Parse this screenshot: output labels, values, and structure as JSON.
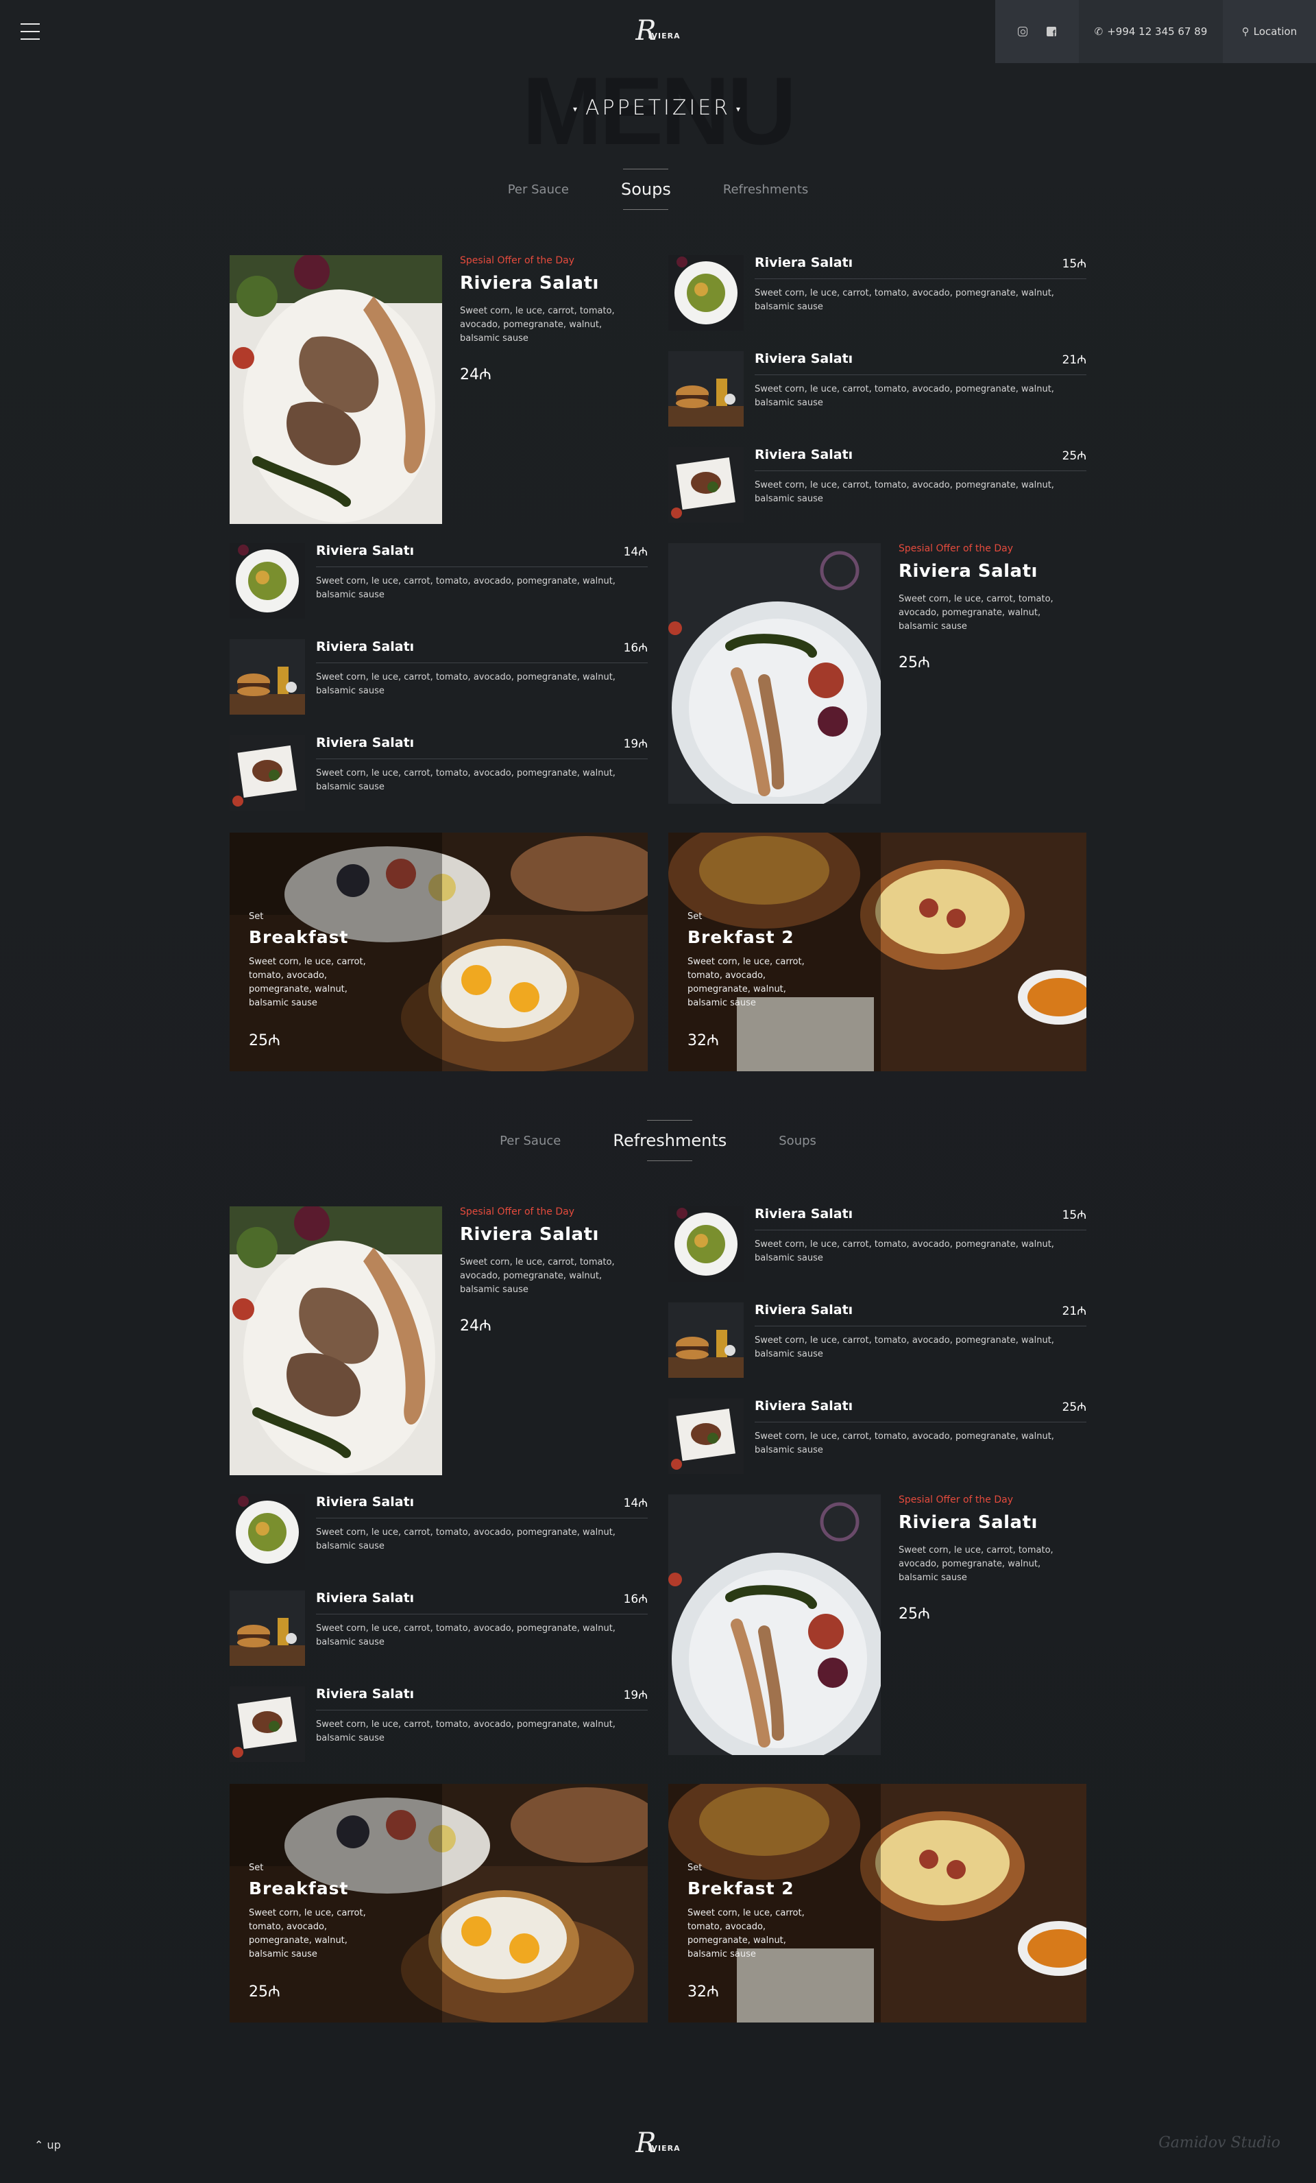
{
  "header": {
    "logo_mono": "R",
    "logo_word": "IVIERA",
    "phone": "+994 12 345 67 89",
    "location": "Location",
    "instagram_icon": "instagram-icon",
    "facebook_icon": "facebook-icon"
  },
  "menu": {
    "ghost_title": "MENU",
    "heading": "APPETIZIER",
    "tri_left": "▾",
    "tri_right": "▾"
  },
  "section1": {
    "tabs": [
      "Per Sauce",
      "Soups",
      "Refreshments"
    ],
    "active_tab": 1
  },
  "section2": {
    "tabs": [
      "Per Sauce",
      "Refreshments",
      "Soups"
    ],
    "active_tab": 1
  },
  "featured": {
    "offer": "Spesial Offer of the Day",
    "title": "Riviera Salatı",
    "desc": "Sweet corn, le uce, carrot, tomato, avocado, pomegranate, walnut, balsamic sause",
    "price1": "24₼",
    "price2": "25₼"
  },
  "items": {
    "title": "Riviera Salatı",
    "desc": "Sweet corn, le uce, carrot, tomato, avocado, pomegranate, walnut, balsamic sause",
    "right_prices": [
      "15₼",
      "21₼",
      "25₼"
    ],
    "left_prices": [
      "14₼",
      "16₼",
      "19₼"
    ]
  },
  "sets": [
    {
      "label": "Set",
      "title": "Breakfast",
      "desc": "Sweet corn, le uce, carrot, tomato, avocado, pomegranate, walnut, balsamic sause",
      "price": "25₼"
    },
    {
      "label": "Set",
      "title": "Brekfast 2",
      "desc": "Sweet corn, le uce, carrot, tomato, avocado, pomegranate, walnut, balsamic sause",
      "price": "32₼"
    }
  ],
  "footer": {
    "up": "up",
    "studio": "Gamidov Studio"
  }
}
